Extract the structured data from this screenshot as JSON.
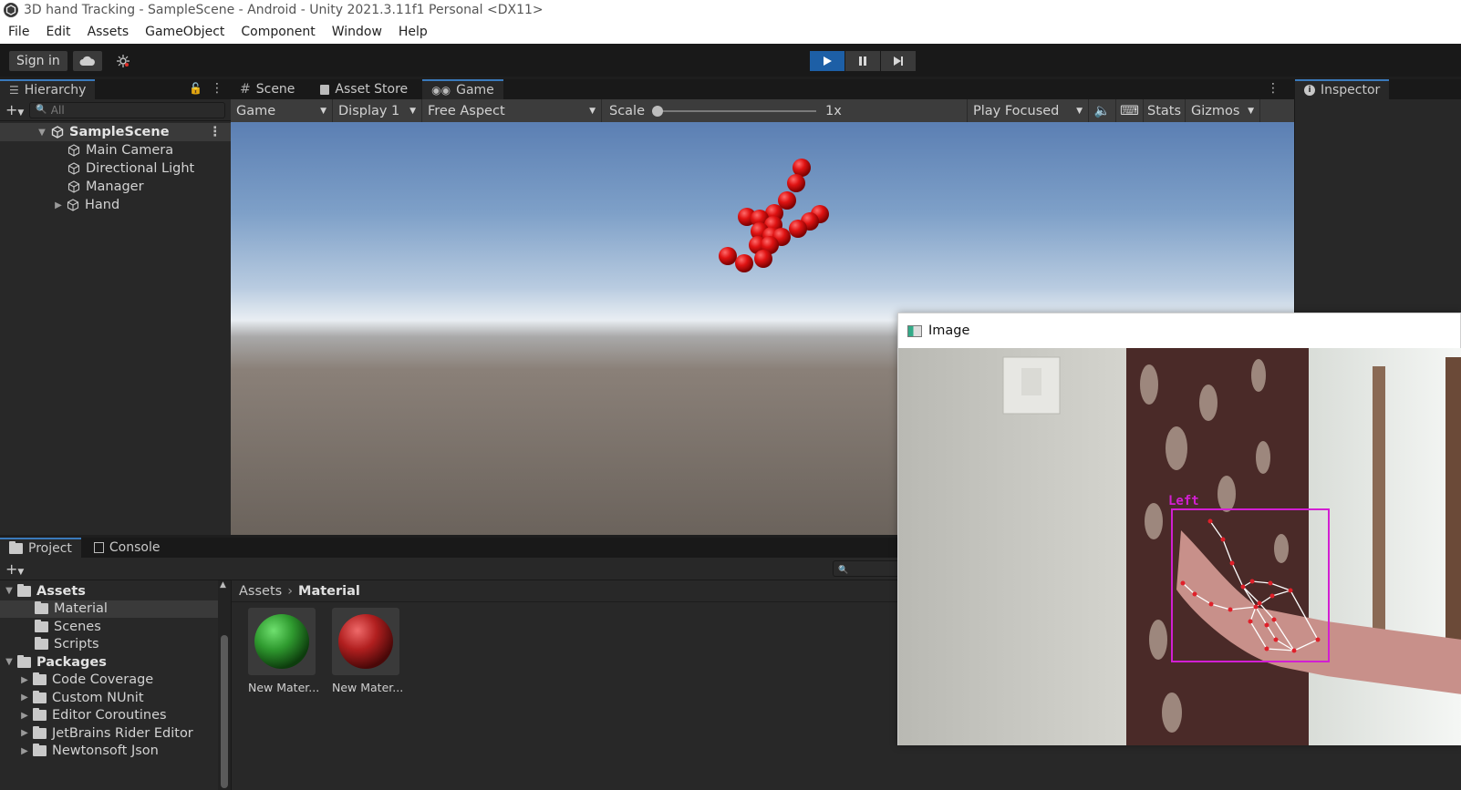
{
  "window": {
    "title": "3D hand Tracking - SampleScene - Android - Unity 2021.3.11f1 Personal <DX11>"
  },
  "menu": [
    "File",
    "Edit",
    "Assets",
    "GameObject",
    "Component",
    "Window",
    "Help"
  ],
  "toolbar": {
    "sign_in": "Sign in"
  },
  "hierarchy": {
    "tab": "Hierarchy",
    "search_placeholder": "All",
    "scene": "SampleScene",
    "items": [
      "Main Camera",
      "Directional Light",
      "Manager",
      "Hand"
    ]
  },
  "center_tabs": [
    "Scene",
    "Asset Store",
    "Game"
  ],
  "game_toolbar": {
    "view": "Game",
    "display": "Display 1",
    "aspect": "Free Aspect",
    "scale_label": "Scale",
    "scale_value": "1x",
    "play_mode": "Play Focused",
    "stats": "Stats",
    "gizmos": "Gizmos"
  },
  "inspector": {
    "tab": "Inspector"
  },
  "project": {
    "tabs": [
      "Project",
      "Console"
    ],
    "breadcrumb": {
      "root": "Assets",
      "current": "Material"
    },
    "tree": {
      "assets": "Assets",
      "asset_children": [
        "Material",
        "Scenes",
        "Scripts"
      ],
      "packages": "Packages",
      "package_children": [
        "Code Coverage",
        "Custom NUnit",
        "Editor Coroutines",
        "JetBrains Rider Editor",
        "Newtonsoft Json"
      ]
    },
    "assets": [
      {
        "label": "New Mater...",
        "color": "#2f9a2f"
      },
      {
        "label": "New Mater...",
        "color": "#b11f1f"
      }
    ]
  },
  "image_window": {
    "title": "Image",
    "hand_label": "Left"
  },
  "colors": {
    "accent": "#3a79bb",
    "play_active": "#1d5fa6",
    "landmark": "#e0202a",
    "bbox": "#d21fd2"
  }
}
